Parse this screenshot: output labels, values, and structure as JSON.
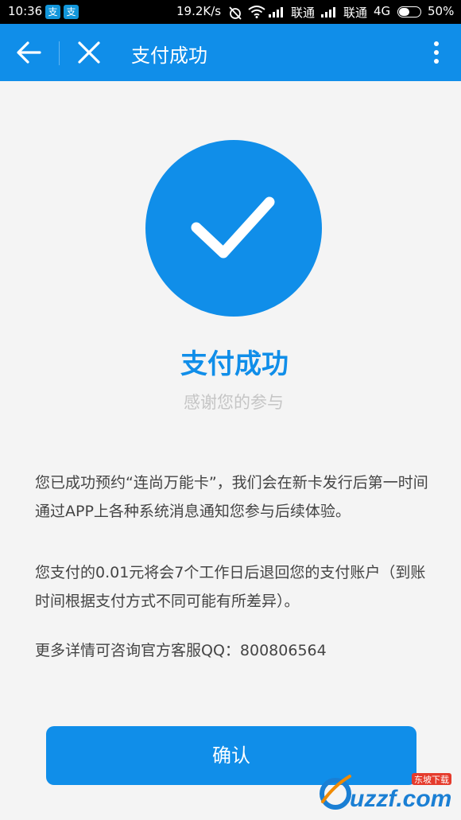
{
  "status_bar": {
    "time": "10:36",
    "app_badges": [
      "支",
      "支"
    ],
    "network_speed": "19.2K/s",
    "carrier_1": "联通",
    "carrier_2": "联通",
    "network_type": "4G",
    "battery": "50%",
    "battery_level": 0.5
  },
  "header": {
    "title": "支付成功"
  },
  "result": {
    "title": "支付成功",
    "subtitle": "感谢您的参与"
  },
  "description": {
    "paragraph_1": "您已成功预约“连尚万能卡”，我们会在新卡发行后第一时间通过APP上各种系统消息通知您参与后续体验。",
    "paragraph_2": "您支付的0.01元将会7个工作日后退回您的支付账户（到账时间根据支付方式不同可能有所差异）。",
    "paragraph_3": "更多详情可咨询官方客服QQ：800806564"
  },
  "confirm_button": {
    "label": "确认"
  },
  "watermark": {
    "text": "uzzf.com",
    "badge_text": "东坡下载"
  },
  "colors": {
    "brand_blue": "#108ee9",
    "background": "#f4f4f4"
  },
  "icons": [
    "back-arrow-icon",
    "close-icon",
    "more-vertical-icon",
    "checkmark-icon"
  ]
}
